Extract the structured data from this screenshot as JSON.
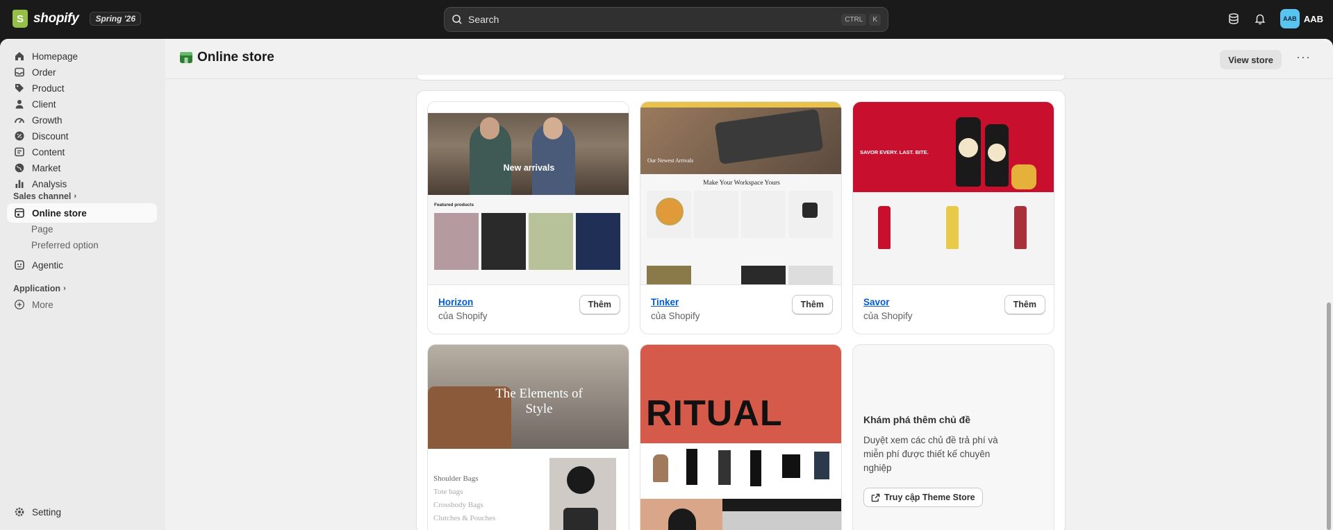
{
  "topbar": {
    "logo_text": "shopify",
    "edition_badge": "Spring '26",
    "search_placeholder": "Search",
    "shortcut_ctrl": "CTRL",
    "shortcut_key": "K",
    "user_initials": "AAB",
    "user_name": "AAB"
  },
  "sidebar": {
    "items": [
      {
        "label": "Homepage",
        "icon": "home-icon"
      },
      {
        "label": "Order",
        "icon": "inbox-icon"
      },
      {
        "label": "Product",
        "icon": "tag-icon"
      },
      {
        "label": "Client",
        "icon": "person-icon"
      },
      {
        "label": "Growth",
        "icon": "gauge-icon"
      },
      {
        "label": "Discount",
        "icon": "discount-icon"
      },
      {
        "label": "Content",
        "icon": "content-icon"
      },
      {
        "label": "Market",
        "icon": "globe-icon"
      },
      {
        "label": "Analysis",
        "icon": "bar-chart-icon"
      }
    ],
    "sales_channel_header": "Sales channel",
    "online_store": "Online store",
    "sub_items": [
      "Page",
      "Preferred option"
    ],
    "agentic": "Agentic",
    "application_header": "Application",
    "more": "More",
    "setting": "Setting"
  },
  "page": {
    "title": "Online store",
    "view_store": "View store"
  },
  "themes": [
    {
      "name": "Horizon",
      "by": "của Shopify",
      "add": "Thêm",
      "hero": "New arrivals",
      "section": "Featured products"
    },
    {
      "name": "Tinker",
      "by": "của Shopify",
      "add": "Thêm",
      "hero": "Our Newest Arrivals",
      "section": "Make Your Workspace Yours"
    },
    {
      "name": "Savor",
      "by": "của Shopify",
      "add": "Thêm",
      "hero": "SAVOR EVERY. LAST. BITE."
    },
    {
      "hero": "The Elements of Style",
      "list": [
        "Shoulder Bags",
        "Tote bags",
        "Crossbody Bags",
        "Clutches & Pouches"
      ]
    },
    {
      "hero": "RITUAL"
    }
  ],
  "explore": {
    "title": "Khám phá thêm chủ đề",
    "description": "Duyệt xem các chủ đề trả phí và miễn phí được thiết kế chuyên nghiệp",
    "button": "Truy cập Theme Store"
  }
}
